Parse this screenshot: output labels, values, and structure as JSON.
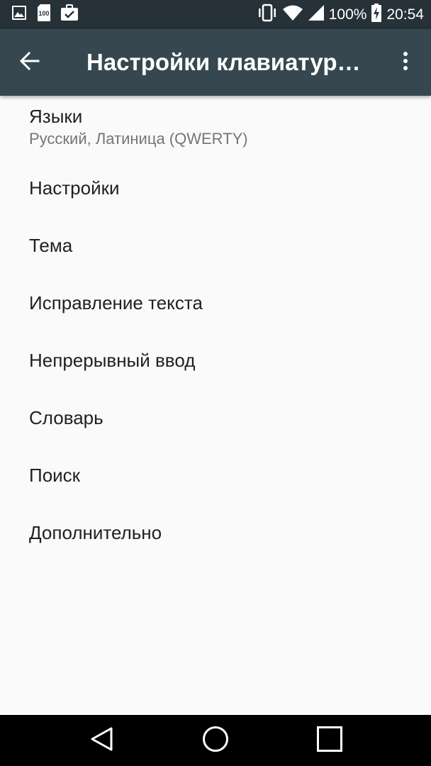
{
  "status_bar": {
    "battery_percent": "100%",
    "time": "20:54",
    "left_icons": [
      "image-icon",
      "sd-card-100-icon",
      "briefcase-check-icon"
    ],
    "right_icons": [
      "vibrate-icon",
      "wifi-icon",
      "cell-signal-icon",
      "battery-charging-icon"
    ]
  },
  "app_bar": {
    "title": "Настройки клавиатуры…",
    "back_icon": "arrow-back-icon",
    "menu_icon": "more-vert-icon"
  },
  "settings": {
    "items": [
      {
        "title": "Языки",
        "summary": "Русский, Латиница (QWERTY)"
      },
      {
        "title": "Настройки"
      },
      {
        "title": "Тема"
      },
      {
        "title": "Исправление текста"
      },
      {
        "title": "Непрерывный ввод"
      },
      {
        "title": "Словарь"
      },
      {
        "title": "Поиск"
      },
      {
        "title": "Дополнительно"
      }
    ]
  },
  "nav_bar": {
    "buttons": [
      "back-triangle-icon",
      "home-circle-icon",
      "recents-square-icon"
    ]
  },
  "colors": {
    "status_bar": "#263238",
    "app_bar": "#37474f",
    "background": "#fafafa",
    "title_text": "#212121",
    "summary_text": "#757575"
  }
}
